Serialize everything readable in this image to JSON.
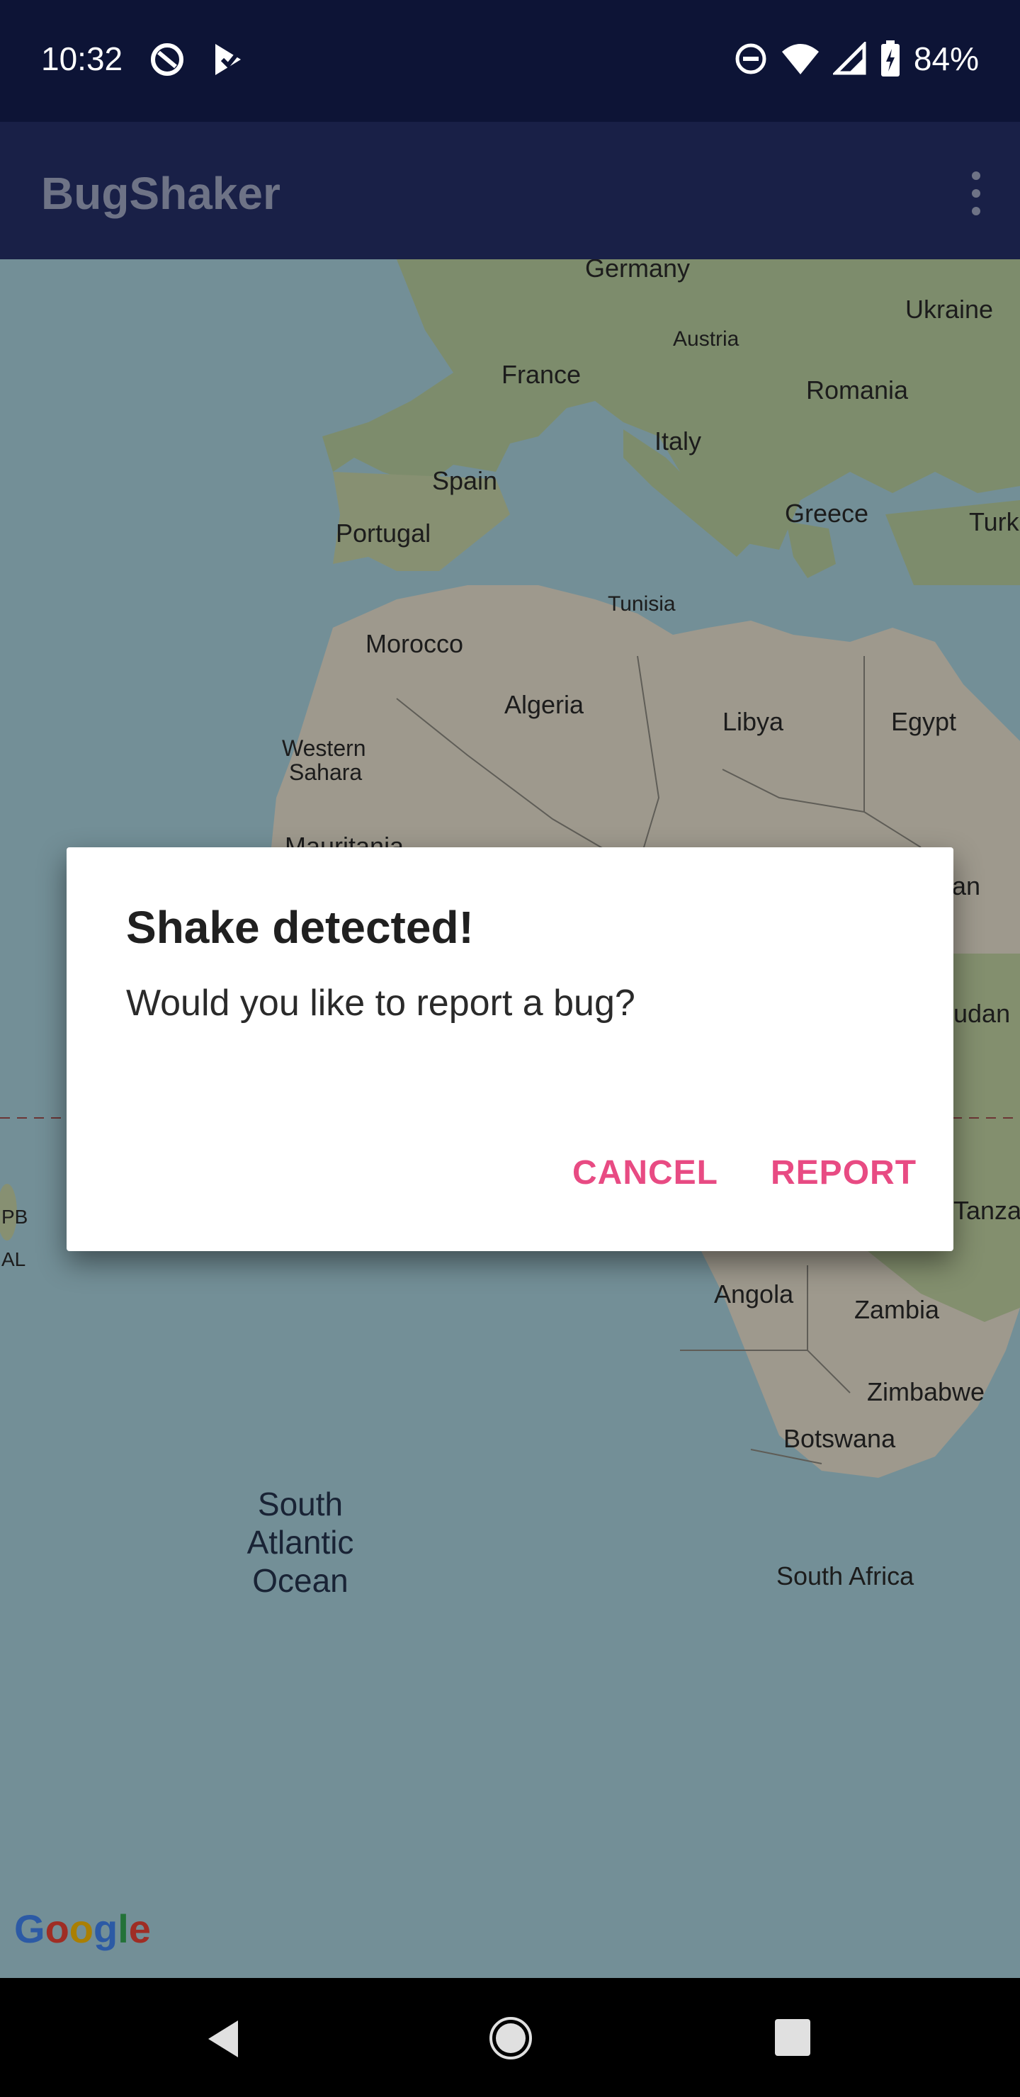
{
  "status_bar": {
    "time": "10:32",
    "battery": "84%",
    "left_icons": [
      "sync-icon",
      "play-store-icon"
    ],
    "right_icons": [
      "dnd-icon",
      "wifi-icon",
      "signal-icon",
      "battery-charging-icon"
    ]
  },
  "app_bar": {
    "title": "BugShaker",
    "overflow_icon": "more-vert-icon"
  },
  "map": {
    "labels": {
      "germany": "Germany",
      "ukraine": "Ukraine",
      "austria": "Austria",
      "france": "France",
      "romania": "Romania",
      "italy": "Italy",
      "spain": "Spain",
      "greece": "Greece",
      "turkey": "Turk",
      "portugal": "Portugal",
      "tunisia": "Tunisia",
      "morocco": "Morocco",
      "algeria": "Algeria",
      "libya": "Libya",
      "egypt": "Egypt",
      "western_sahara_1": "Western",
      "western_sahara_2": "Sahara",
      "mauritania": "Mauritania",
      "sudan_partial": "an",
      "south_sudan_partial": "udan",
      "tanzania_partial": "Tanza",
      "pb": "PB",
      "al": "AL",
      "angola": "Angola",
      "zambia": "Zambia",
      "zimbabwe": "Zimbabwe",
      "botswana": "Botswana",
      "south_africa": "South Africa",
      "ocean_1": "South",
      "ocean_2": "Atlantic",
      "ocean_3": "Ocean"
    },
    "attribution": "Google",
    "colors": {
      "water": "#aad3df",
      "land": "#e9e2d0",
      "vegetation": "#b9cf9f"
    }
  },
  "dialog": {
    "title": "Shake detected!",
    "message": "Would you like to report a bug?",
    "cancel_label": "CANCEL",
    "report_label": "REPORT",
    "accent_color": "#e84b83"
  },
  "nav_bar": {
    "back_icon": "back-icon",
    "home_icon": "home-icon",
    "recents_icon": "recents-icon"
  }
}
